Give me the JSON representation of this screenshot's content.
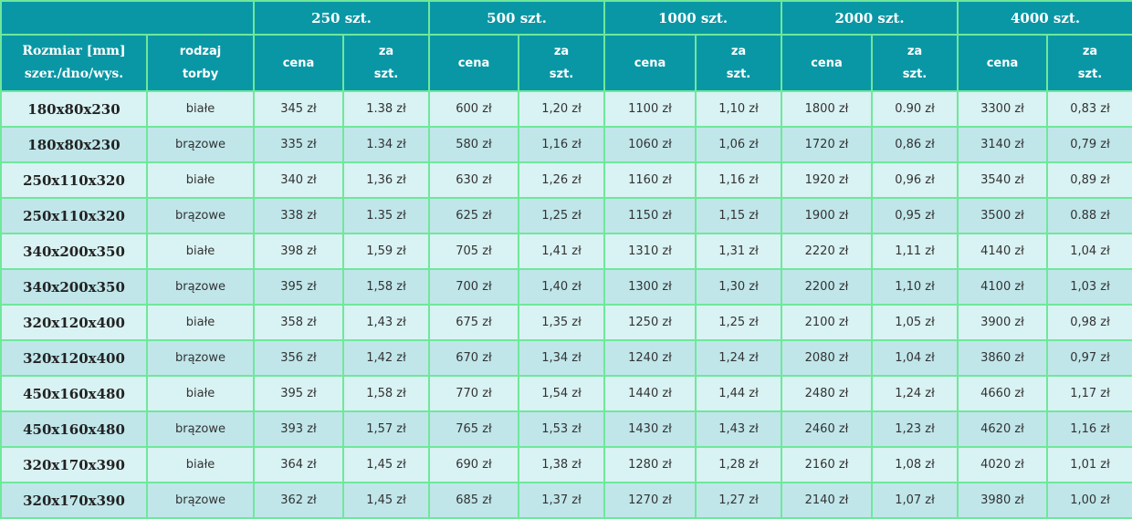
{
  "header": {
    "quantities": [
      "250 szt.",
      "500 szt.",
      "1000 szt.",
      "2000 szt.",
      "4000 szt."
    ],
    "size_label_line1": "Rozmiar [mm]",
    "size_label_line2": "szer./dno/wys.",
    "type_label_line1": "rodzaj",
    "type_label_line2": "torby",
    "price_label": "cena",
    "per_unit_line1": "za",
    "per_unit_line2": "szt."
  },
  "rows": [
    {
      "size": "180x80x230",
      "type": "białe",
      "p250": "345 zł",
      "u250": "1.38 zł",
      "p500": "600 zł",
      "u500": "1,20 zł",
      "p1000": "1100 zł",
      "u1000": "1,10 zł",
      "p2000": "1800 zł",
      "u2000": "0.90 zł",
      "p4000": "3300 zł",
      "u4000": "0,83 zł"
    },
    {
      "size": "180x80x230",
      "type": "brązowe",
      "p250": "335 zł",
      "u250": "1.34 zł",
      "p500": "580 zł",
      "u500": "1,16 zł",
      "p1000": "1060 zł",
      "u1000": "1,06 zł",
      "p2000": "1720 zł",
      "u2000": "0,86 zł",
      "p4000": "3140 zł",
      "u4000": "0,79 zł"
    },
    {
      "size": "250x110x320",
      "type": "białe",
      "p250": "340 zł",
      "u250": "1,36 zł",
      "p500": "630 zł",
      "u500": "1,26 zł",
      "p1000": "1160 zł",
      "u1000": "1,16 zł",
      "p2000": "1920 zł",
      "u2000": "0,96 zł",
      "p4000": "3540 zł",
      "u4000": "0,89 zł"
    },
    {
      "size": "250x110x320",
      "type": "brązowe",
      "p250": "338 zł",
      "u250": "1.35 zł",
      "p500": "625 zł",
      "u500": "1,25 zł",
      "p1000": "1150 zł",
      "u1000": "1,15 zł",
      "p2000": "1900 zł",
      "u2000": "0,95 zł",
      "p4000": "3500 zł",
      "u4000": "0.88 zł"
    },
    {
      "size": "340x200x350",
      "type": "białe",
      "p250": "398 zł",
      "u250": "1,59 zł",
      "p500": "705 zł",
      "u500": "1,41 zł",
      "p1000": "1310 zł",
      "u1000": "1,31 zł",
      "p2000": "2220 zł",
      "u2000": "1,11 zł",
      "p4000": "4140 zł",
      "u4000": "1,04 zł"
    },
    {
      "size": "340x200x350",
      "type": "brązowe",
      "p250": "395 zł",
      "u250": "1,58 zł",
      "p500": "700 zł",
      "u500": "1,40 zł",
      "p1000": "1300 zł",
      "u1000": "1,30 zł",
      "p2000": "2200 zł",
      "u2000": "1,10 zł",
      "p4000": "4100 zł",
      "u4000": "1,03 zł"
    },
    {
      "size": "320x120x400",
      "type": "białe",
      "p250": "358 zł",
      "u250": "1,43 zł",
      "p500": "675 zł",
      "u500": "1,35 zł",
      "p1000": "1250 zł",
      "u1000": "1,25 zł",
      "p2000": "2100 zł",
      "u2000": "1,05 zł",
      "p4000": "3900 zł",
      "u4000": "0,98 zł"
    },
    {
      "size": "320x120x400",
      "type": "brązowe",
      "p250": "356 zł",
      "u250": "1,42 zł",
      "p500": "670 zł",
      "u500": "1,34 zł",
      "p1000": "1240 zł",
      "u1000": "1,24 zł",
      "p2000": "2080 zł",
      "u2000": "1,04 zł",
      "p4000": "3860 zł",
      "u4000": "0,97 zł"
    },
    {
      "size": "450x160x480",
      "type": "białe",
      "p250": "395 zł",
      "u250": "1,58 zł",
      "p500": "770 zł",
      "u500": "1,54 zł",
      "p1000": "1440 zł",
      "u1000": "1,44 zł",
      "p2000": "2480 zł",
      "u2000": "1,24 zł",
      "p4000": "4660 zł",
      "u4000": "1,17 zł"
    },
    {
      "size": "450x160x480",
      "type": "brązowe",
      "p250": "393 zł",
      "u250": "1,57 zł",
      "p500": "765 zł",
      "u500": "1,53 zł",
      "p1000": "1430 zł",
      "u1000": "1,43 zł",
      "p2000": "2460 zł",
      "u2000": "1,23 zł",
      "p4000": "4620 zł",
      "u4000": "1,16 zł"
    },
    {
      "size": "320x170x390",
      "type": "białe",
      "p250": "364 zł",
      "u250": "1,45 zł",
      "p500": "690 zł",
      "u500": "1,38 zł",
      "p1000": "1280 zł",
      "u1000": "1,28 zł",
      "p2000": "2160 zł",
      "u2000": "1,08 zł",
      "p4000": "4020 zł",
      "u4000": "1,01 zł"
    },
    {
      "size": "320x170x390",
      "type": "brązowe",
      "p250": "362 zł",
      "u250": "1,45 zł",
      "p500": "685 zł",
      "u500": "1,37 zł",
      "p1000": "1270 zł",
      "u1000": "1,27 zł",
      "p2000": "2140 zł",
      "u2000": "1,07 zł",
      "p4000": "3980 zł",
      "u4000": "1,00 zł"
    }
  ]
}
